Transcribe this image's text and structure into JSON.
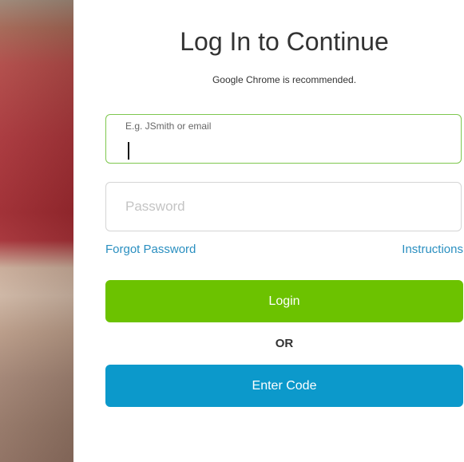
{
  "login": {
    "title": "Log In to Continue",
    "subtitle": "Google Chrome is recommended.",
    "username": {
      "label": "E.g. JSmith or email",
      "value": ""
    },
    "password": {
      "placeholder": "Password",
      "value": ""
    },
    "forgot_password_link": "Forgot Password",
    "instructions_link": "Instructions",
    "login_button": "Login",
    "separator": "OR",
    "enter_code_button": "Enter Code"
  },
  "colors": {
    "login_button": "#6cc200",
    "enter_code_button": "#0c99cb",
    "link": "#2a8fc0",
    "focused_border": "#7ec74e"
  }
}
